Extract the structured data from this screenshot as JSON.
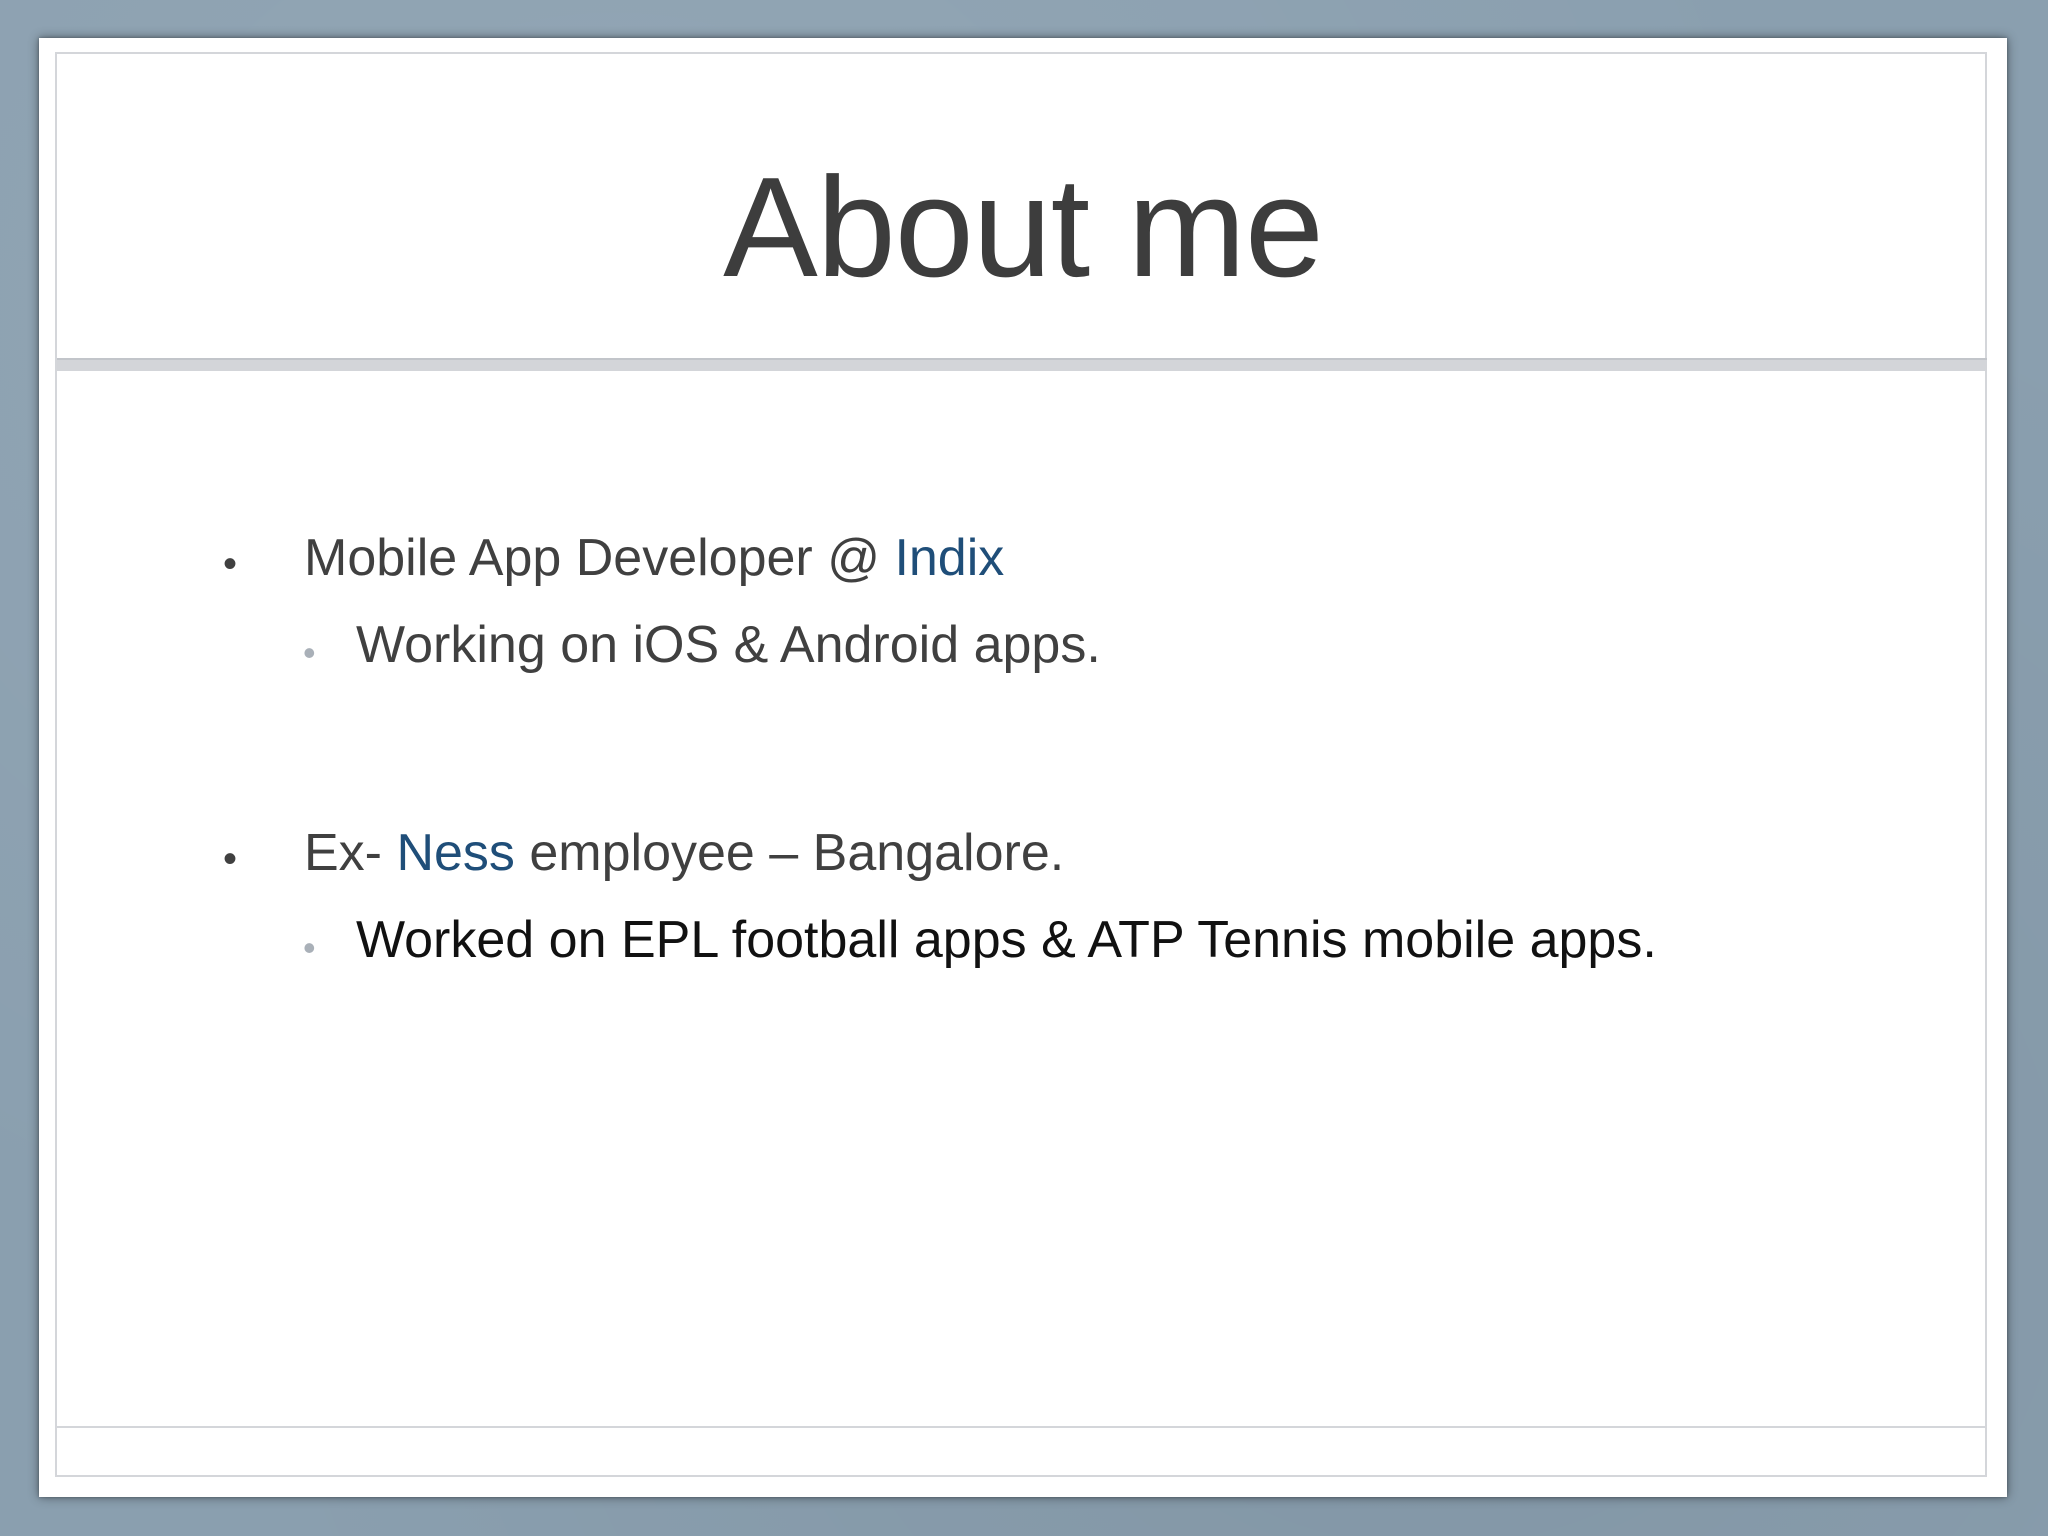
{
  "slide": {
    "title": "About me",
    "items": [
      {
        "bullet": "•",
        "text_before": "Mobile App Developer @ ",
        "highlight": "Indix",
        "text_after": "",
        "sub": {
          "bullet": "•",
          "text": "Working on iOS & Android apps."
        }
      },
      {
        "bullet": "•",
        "text_before": "Ex- ",
        "highlight": "Ness",
        "text_after": " employee – Bangalore.",
        "sub": {
          "bullet": "•",
          "text": "Worked on EPL football apps & ATP Tennis mobile apps."
        }
      }
    ]
  },
  "colors": {
    "background": "#8a9faf",
    "title": "#3d3d3d",
    "body_text": "#404040",
    "accent_link": "#1f4e79",
    "sub_bullet": "#a9b0b8",
    "rule": "#d3d5d9"
  }
}
